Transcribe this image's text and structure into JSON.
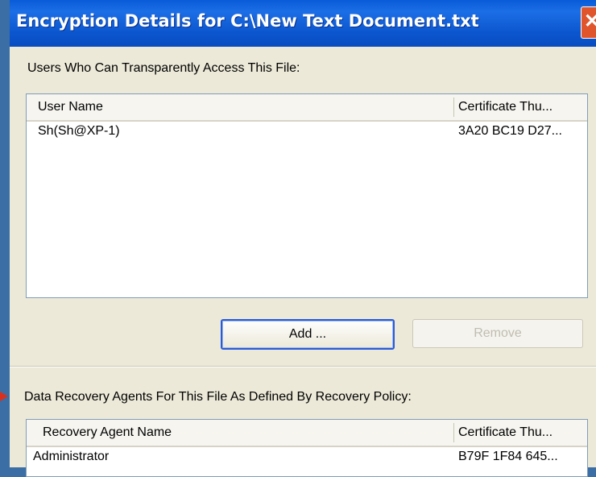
{
  "window": {
    "title": "Encryption Details for C:\\New Text Document.txt",
    "close_glyph": "✕"
  },
  "users_section": {
    "label": "Users Who Can Transparently Access This File:",
    "columns": [
      "User Name",
      "Certificate Thu..."
    ],
    "rows": [
      {
        "name": "Sh(Sh@XP-1)",
        "thumb": "3A20 BC19 D27..."
      }
    ]
  },
  "buttons": {
    "add": "Add ...",
    "remove": "Remove"
  },
  "recovery_section": {
    "label": "Data Recovery Agents For This File As Defined By Recovery Policy:",
    "columns": [
      "Recovery Agent Name",
      "Certificate Thu..."
    ],
    "rows": [
      {
        "name": "Administrator",
        "thumb": "B79F 1F84 645..."
      }
    ]
  },
  "colors": {
    "titlebar": "#0a5bd8",
    "dialog_bg": "#ece9d8",
    "close": "#e0552b",
    "pointer_arrow": "#d9301e"
  }
}
